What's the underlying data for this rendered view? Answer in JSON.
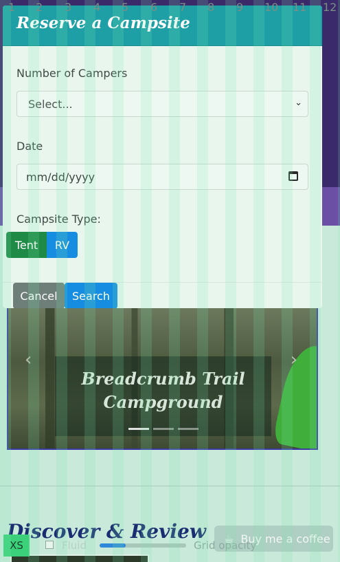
{
  "modal": {
    "title": "Reserve a Campsite",
    "campers_label": "Number of Campers",
    "campers_selected": "Select...",
    "date_label": "Date",
    "date_placeholder": "mm/dd/yyyy",
    "type_label": "Campsite Type:",
    "type_options": [
      "Tent",
      "RV"
    ],
    "cancel_label": "Cancel",
    "search_label": "Search"
  },
  "carousel": {
    "caption_line1": "Breadcrumb Trail",
    "caption_line2": "Campground",
    "prev_glyph": "‹",
    "next_glyph": "›",
    "slide_count": 3,
    "active_slide": 1
  },
  "discover": {
    "title": "Discover & Review"
  },
  "coffee": {
    "label": "Buy me a coffee",
    "icon": "coffee-cup-icon"
  },
  "grid_debug": {
    "breakpoint": "XS",
    "fluid_label": "Fluid",
    "opacity_label": "Grid opacity",
    "opacity_value": 0.3,
    "columns": [
      "1",
      "2",
      "3",
      "4",
      "5",
      "6",
      "7",
      "8",
      "9",
      "10",
      "11",
      "12"
    ]
  },
  "colors": {
    "modal_header": "#1e9fa6",
    "tent_button": "#1f8a45",
    "rv_button": "#168de0",
    "cancel_button": "#6e7f7a",
    "search_button": "#168de0"
  }
}
